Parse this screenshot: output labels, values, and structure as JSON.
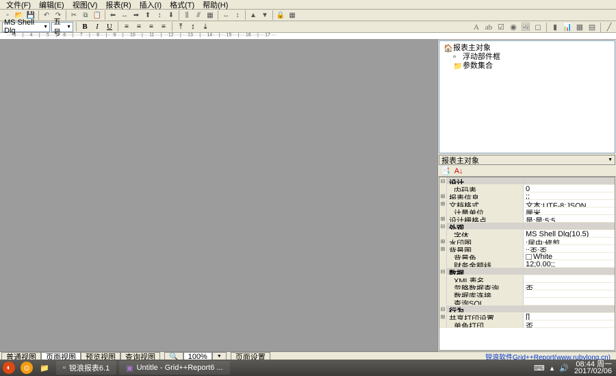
{
  "menu": [
    "文件(F)",
    "编辑(E)",
    "视图(V)",
    "报表(R)",
    "插入(I)",
    "格式(T)",
    "帮助(H)"
  ],
  "font": {
    "name": "MS Shell Dlg",
    "size": "五号"
  },
  "fmt": {
    "bold": "B",
    "italic": "I",
    "underline": "U"
  },
  "ruler": "····3····|····4····|····5····|····6····|····7····|····8····|····9····|····10····|····11····|····12····|····13····|····14····|····15····|····16····|····17····",
  "tree": {
    "root": "报表主对象",
    "items": [
      "浮动部件框",
      "参数集合"
    ]
  },
  "prop_header": "报表主对象",
  "props": [
    {
      "cat": true,
      "exp": "⊟",
      "name": "设计"
    },
    {
      "name": "内码表",
      "val": "0",
      "indent": true
    },
    {
      "exp": "⊞",
      "name": "报表信息",
      "val": ";;"
    },
    {
      "exp": "⊞",
      "name": "文档格式",
      "val": "文本:UTF-8;JSON"
    },
    {
      "name": "计量单位",
      "val": "厘米",
      "indent": true
    },
    {
      "exp": "⊞",
      "name": "设计栅格点",
      "val": "是;是;5;5"
    },
    {
      "cat": true,
      "exp": "⊟",
      "name": "外观"
    },
    {
      "name": "字体",
      "val": "MS Shell Dlg(10.5)",
      "indent": true
    },
    {
      "exp": "⊞",
      "name": "水印图",
      "val": ";居中;修剪"
    },
    {
      "exp": "⊞",
      "name": "背景图",
      "val": ";;否;否"
    },
    {
      "name": "背景色",
      "val": "White",
      "color": "#fff",
      "indent": true
    },
    {
      "name": "财务金额线",
      "val": "12;0.00;;",
      "indent": true
    },
    {
      "cat": true,
      "exp": "⊟",
      "name": "数据"
    },
    {
      "name": "XML表名",
      "val": "",
      "indent": true
    },
    {
      "name": "忽略数据查询",
      "val": "否",
      "indent": true
    },
    {
      "name": "数据库连接",
      "val": "",
      "indent": true
    },
    {
      "name": "查询SQL",
      "val": "",
      "indent": true
    },
    {
      "cat": true,
      "exp": "⊟",
      "name": "行为"
    },
    {
      "exp": "⊞",
      "name": "共享打印设置",
      "val": "[]"
    },
    {
      "name": "单色打印",
      "val": "否",
      "indent": true
    }
  ],
  "tabs": [
    "普通视图",
    "页面视图",
    "预览视图",
    "查询视图"
  ],
  "active_tab": 1,
  "zoom": "100%",
  "page_setup": "页面设置",
  "credit": "锐浪软件Grid++Report(www.rubylong.cn)",
  "taskbar": {
    "app1": "锐浪报表6.1",
    "app2": "Untitle - Grid++Report6 ...",
    "time": "08:44 周一",
    "date": "2017/02/06"
  }
}
